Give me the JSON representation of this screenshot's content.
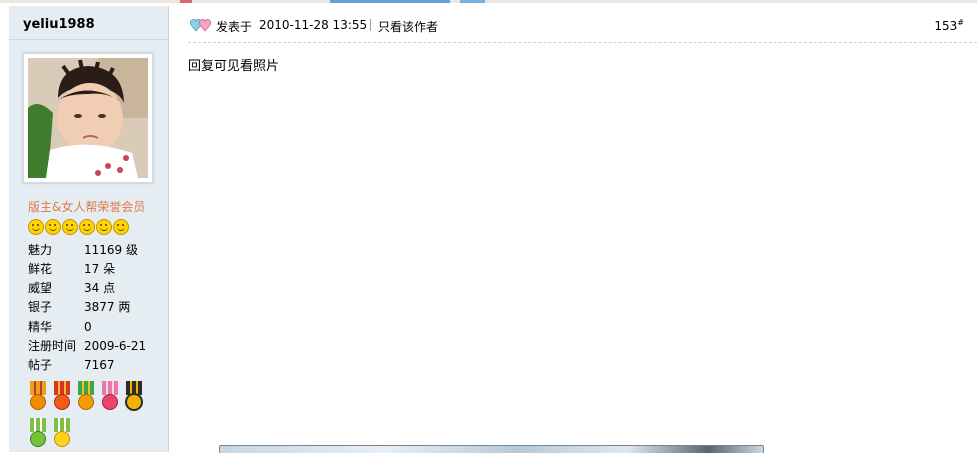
{
  "user": {
    "name": "yeliu1988",
    "group": "版主&女人帮荣誉会员",
    "star_icons": [
      "smile-icon",
      "smile-icon",
      "smile-icon",
      "smile-icon",
      "smile-icon",
      "smile-icon"
    ],
    "stats": [
      {
        "label": "魅力",
        "value": "11169 级"
      },
      {
        "label": "鲜花",
        "value": "17 朵"
      },
      {
        "label": "威望",
        "value": "34 点"
      },
      {
        "label": "银子",
        "value": "3877 两"
      },
      {
        "label": "精华",
        "value": "0"
      },
      {
        "label": "注册时间",
        "value": "2009-6-21"
      },
      {
        "label": "帖子",
        "value": "7167"
      }
    ],
    "medals": [
      {
        "icon": "sun-medal-icon",
        "ribbon": "#e8a317",
        "disc": "#f28b00"
      },
      {
        "icon": "red-star-medal-icon",
        "ribbon": "#d9332a",
        "disc": "#f25a1e"
      },
      {
        "icon": "green-sun-medal-icon",
        "ribbon": "#3aa54a",
        "disc": "#f59b00"
      },
      {
        "icon": "pink-flower-medal-icon",
        "ribbon": "#e879a6",
        "disc": "#e8446e"
      },
      {
        "icon": "black-gold-medal-icon",
        "ribbon": "#2c2c2c",
        "disc": "#f0b400"
      },
      {
        "icon": "green-round-medal-icon",
        "ribbon": "#7dc142",
        "disc": "#73c43a"
      },
      {
        "icon": "smile-medal-icon",
        "ribbon": "#7dc142",
        "disc": "#ffd21e"
      }
    ]
  },
  "post": {
    "posted_label": "发表于",
    "time": "2010-11-28 13:55",
    "only_author": "只看该作者",
    "floor": "153",
    "floor_mark": "#",
    "content": "回复可见看照片"
  },
  "colors": {
    "sidebar_bg": "#e5edf2",
    "group_text": "#e07a4a"
  }
}
